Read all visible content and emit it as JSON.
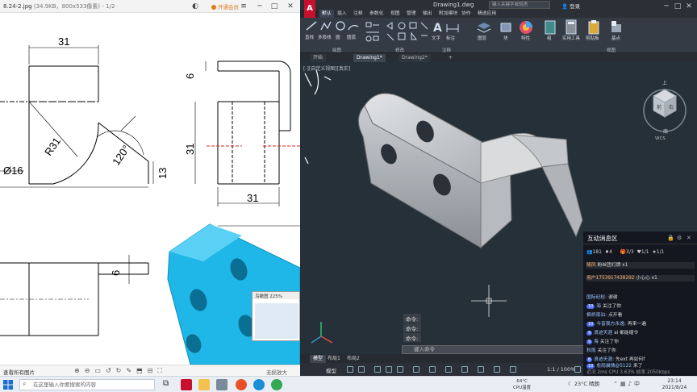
{
  "viewer": {
    "filename": "8.24-2.jpg",
    "file_meta": "(34.9KB，800x533像素)",
    "page": "- 1/2",
    "vip_label": "开通会员",
    "view_all": "查看所有图片",
    "no_zoom": "无损放大",
    "thumb_title": "鸟瞰图 225%",
    "dimensions": {
      "top_width": "31",
      "radius": "R31",
      "diameter": "Ø16",
      "angle": "120°",
      "right_height": "13",
      "side_top": "6",
      "side_height": "31",
      "side_width": "31",
      "bottom_thickness": "6"
    }
  },
  "acad": {
    "logo": "A",
    "document_title": "Drawing1.dwg",
    "search_placeholder": "键入关键字或短语",
    "login": "登录",
    "menus": [
      "默认",
      "插入",
      "注释",
      "参数化",
      "视图",
      "管理",
      "输出",
      "附加模块",
      "协作",
      "精选应用"
    ],
    "ribbon": {
      "draw_tools": [
        "直线",
        "多段线",
        "圆",
        "圆弧"
      ],
      "text": "文字",
      "dim": "标注",
      "layer": "图层",
      "block": "块",
      "properties": "特性",
      "group": "组",
      "utilities": "实用工具",
      "clipboard": "剪贴板",
      "base": "基点",
      "groups": [
        "绘图",
        "修改",
        "注释",
        "视图"
      ]
    },
    "tabs": [
      "开始",
      "Drawing1*",
      "Drawing2*"
    ],
    "view_label": "[-][自定义视图][真实]",
    "cube_labels": {
      "top": "上",
      "front": "前",
      "right": "右",
      "south": "南",
      "wcs": "WCS"
    },
    "cmd_lines": [
      "命令:",
      "命令:",
      "命令:"
    ],
    "cmd_placeholder": "键入命令",
    "layout_tabs": [
      "模型",
      "布局1",
      "布局2"
    ],
    "status": {
      "model": "模型",
      "zoom": "1:1 / 100%"
    }
  },
  "live_panel": {
    "title": "互动消息区",
    "stats": {
      "viewers": "181",
      "likes": "4",
      "gifts_a": "3/3",
      "gifts_b": "1/1",
      "gifts_c": "1/1"
    },
    "messages": [
      {
        "user": "随风",
        "text": "粉丝团灯牌",
        "suffix": "x1"
      },
      {
        "user": "用户1753917438292",
        "text": "小心心",
        "suffix": "x1"
      },
      {
        "user": "国际纪检:",
        "text": "谢谢"
      },
      {
        "level": "10",
        "user": "海",
        "text": "关注了你"
      },
      {
        "user": "枫桥夜泊:",
        "text": "点开看"
      },
      {
        "level": "10",
        "user": "今昔我方永逸:",
        "text": "再来一遍"
      },
      {
        "level": "9",
        "user": "浪迹天涯",
        "text": "al 都能缩令"
      },
      {
        "level": "9",
        "user": "海",
        "text": "关注了你"
      },
      {
        "user": "秋雨",
        "text": "关注了你"
      },
      {
        "level": "8",
        "user": "浪迹天涯:",
        "text": "先ext 再如何f"
      },
      {
        "level": "10",
        "user": "愈雨晨情@5122",
        "text": "来了"
      },
      {
        "user": "近况 2ms",
        "text": "CPU 3.63%  帧率 2050kbps"
      }
    ]
  },
  "taskbar": {
    "search_placeholder": "在这里输入你要搜索的内容",
    "weather": "23°C 晴朗",
    "cpu_temp": "64°C",
    "cpu_label": "CPU温度",
    "time": "23:14",
    "date": "2021/8/24"
  }
}
